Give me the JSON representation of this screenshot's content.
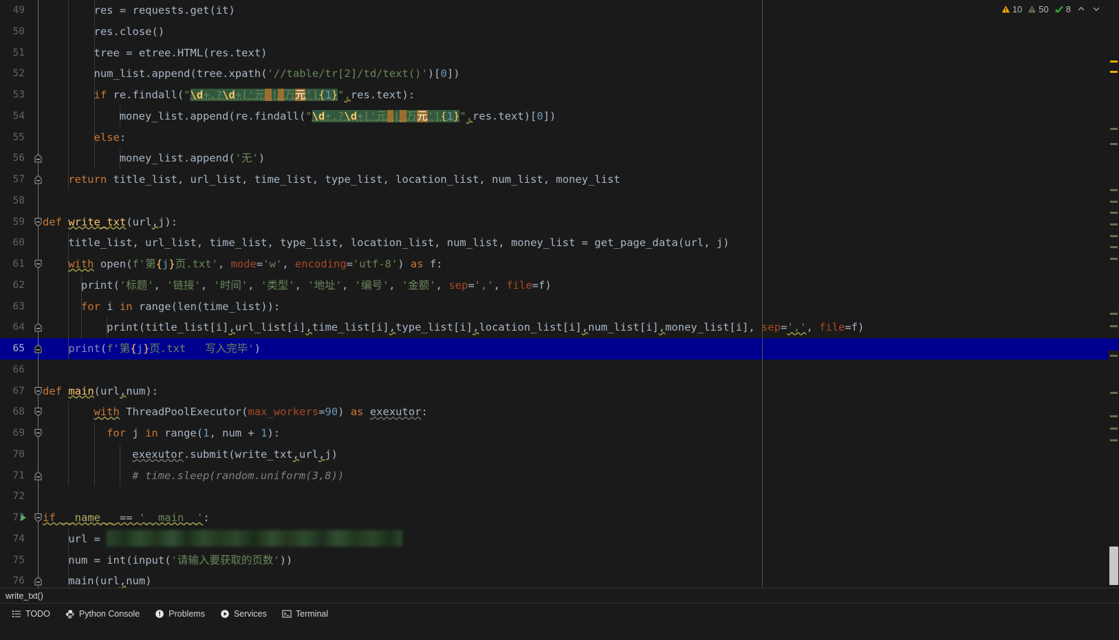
{
  "editor": {
    "first_line_number": 49,
    "current_line": 65,
    "lines": [
      {
        "n": 49,
        "indent_guides": 1,
        "fold": "none"
      },
      {
        "n": 50,
        "indent_guides": 1,
        "fold": "none"
      },
      {
        "n": 51,
        "indent_guides": 1,
        "fold": "none"
      },
      {
        "n": 52,
        "indent_guides": 1,
        "fold": "none"
      },
      {
        "n": 53,
        "indent_guides": 1,
        "fold": "none"
      },
      {
        "n": 54,
        "indent_guides": 2,
        "fold": "none"
      },
      {
        "n": 55,
        "indent_guides": 1,
        "fold": "none"
      },
      {
        "n": 56,
        "indent_guides": 2,
        "fold": "end"
      },
      {
        "n": 57,
        "indent_guides": 0,
        "fold": "end"
      },
      {
        "n": 58,
        "indent_guides": 0,
        "fold": "none"
      },
      {
        "n": 59,
        "indent_guides": 0,
        "fold": "start"
      },
      {
        "n": 60,
        "indent_guides": 0,
        "fold": "none"
      },
      {
        "n": 61,
        "indent_guides": 0,
        "fold": "start"
      },
      {
        "n": 62,
        "indent_guides": 1,
        "fold": "none"
      },
      {
        "n": 63,
        "indent_guides": 1,
        "fold": "none"
      },
      {
        "n": 64,
        "indent_guides": 2,
        "fold": "end"
      },
      {
        "n": 65,
        "indent_guides": 0,
        "fold": "end"
      },
      {
        "n": 66,
        "indent_guides": 0,
        "fold": "none"
      },
      {
        "n": 67,
        "indent_guides": 0,
        "fold": "start"
      },
      {
        "n": 68,
        "indent_guides": 0,
        "fold": "start"
      },
      {
        "n": 69,
        "indent_guides": 1,
        "fold": "start"
      },
      {
        "n": 70,
        "indent_guides": 2,
        "fold": "none"
      },
      {
        "n": 71,
        "indent_guides": 2,
        "fold": "end"
      },
      {
        "n": 72,
        "indent_guides": 0,
        "fold": "none"
      },
      {
        "n": 73,
        "indent_guides": 0,
        "fold": "start",
        "run_arrow": true
      },
      {
        "n": 74,
        "indent_guides": 0,
        "fold": "none"
      },
      {
        "n": 75,
        "indent_guides": 0,
        "fold": "none"
      },
      {
        "n": 76,
        "indent_guides": 0,
        "fold": "end"
      }
    ],
    "source_text": {
      "l49": "        res = requests.get(it)",
      "l50": "        res.close()",
      "l51": "        tree = etree.HTML(res.text)",
      "l52": "        num_list.append(tree.xpath('//table/tr[2]/td/text()')[0])",
      "l53": "        if re.findall(\"\\d+.?\\d+['元'|'万元']{1}\",res.text):",
      "l54": "            money_list.append(re.findall(\"\\d+.?\\d+['元'|'万元']{1}\",res.text)[0])",
      "l55": "        else:",
      "l56": "            money_list.append('无')",
      "l57": "    return title_list, url_list, time_list, type_list, location_list, num_list, money_list",
      "l58": "",
      "l59": "def write_txt(url,j):",
      "l60": "    title_list, url_list, time_list, type_list, location_list, num_list, money_list = get_page_data(url, j)",
      "l61": "    with open(f'第{j}页.txt', mode='w', encoding='utf-8') as f:",
      "l62": "        print('标题', '链接', '时间', '类型', '地址', '编号', '金额', sep=',', file=f)",
      "l63": "        for i in range(len(time_list)):",
      "l64": "            print(title_list[i],url_list[i],time_list[i],type_list[i],location_list[i],num_list[i],money_list[i], sep=',', file=f)",
      "l65": "    print(f'第{j}页.txt   写入完毕')",
      "l66": "",
      "l67": "def main(url,num):",
      "l68": "        with ThreadPoolExecutor(max_workers=90) as exexutor:",
      "l69": "            for j in range(1, num + 1):",
      "l70": "                exexutor.submit(write_txt,url,j)",
      "l71": "                # time.sleep(random.uniform(3,8))",
      "l72": "",
      "l73": "if __name__ == '__main__':",
      "l74": "    url = '█████████████████████'",
      "l75": "    num = int(input('请输入要获取的页数'))",
      "l76": "    main(url,num)"
    },
    "search_highlight_term": "\\d+.?\\d+['元'|'万元']{1}"
  },
  "inspection_widget": {
    "warnings_icon": "warning-triangle-icon",
    "warnings_count": "10",
    "weak_warnings_icon": "weak-warning-triangle-icon",
    "weak_warnings_count": "50",
    "typos_icon": "typo-check-icon",
    "typos_count": "8",
    "prev_problem_icon": "chevron-up-icon",
    "next_problem_icon": "chevron-down-icon"
  },
  "breadcrumb": {
    "text": "write_txt()"
  },
  "toolwindows": [
    {
      "label": "TODO",
      "icon": "todo-list-icon"
    },
    {
      "label": "Python Console",
      "icon": "python-console-icon"
    },
    {
      "label": "Problems",
      "icon": "problems-icon"
    },
    {
      "label": "Services",
      "icon": "services-play-icon"
    },
    {
      "label": "Terminal",
      "icon": "terminal-icon"
    }
  ],
  "colors": {
    "editor_bg": "#1a1a1a",
    "caret_row": "#00008f",
    "keyword": "#cc7832",
    "string": "#6a8759",
    "number": "#6897bb",
    "function": "#ffc66d",
    "comment": "#808080",
    "param": "#aa4926",
    "identifier": "#a9b7c6",
    "search_match": "#32593d",
    "search_group": "#9e6c2b",
    "warning_marker": "#f2a900",
    "weak_marker": "#6e6a54",
    "run_arrow": "#59a869"
  }
}
